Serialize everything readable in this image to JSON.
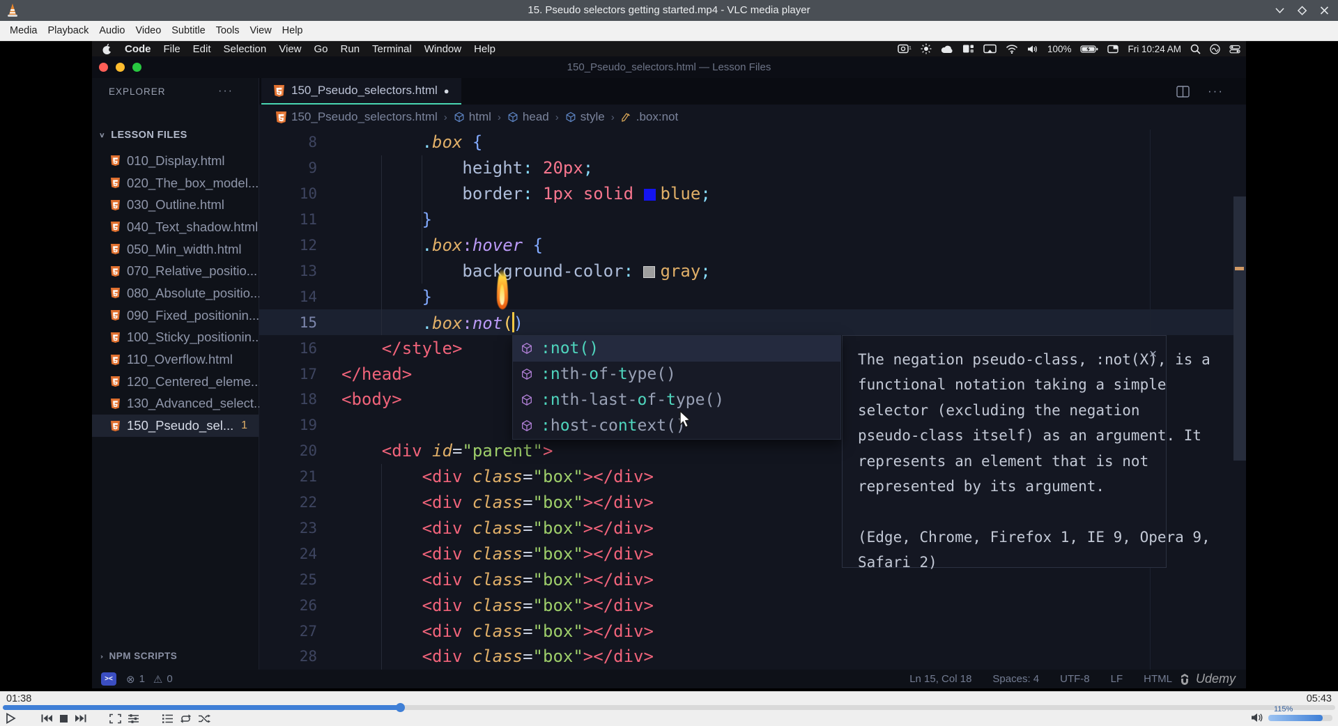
{
  "vlc": {
    "title": "15. Pseudo selectors getting started.mp4 - VLC media player",
    "menu": [
      "Media",
      "Playback",
      "Audio",
      "Video",
      "Subtitle",
      "Tools",
      "View",
      "Help"
    ],
    "window_icons": [
      "minimize-icon",
      "maximize-icon",
      "close-icon"
    ],
    "time_elapsed": "01:38",
    "time_total": "05:43",
    "volume_label": "115%",
    "transport_icons": [
      "play-icon",
      "previous-icon",
      "stop-icon",
      "next-icon",
      "fullscreen-icon",
      "extended-settings-icon",
      "playlist-icon",
      "loop-icon",
      "shuffle-icon"
    ],
    "accent_color": "#3f7fd6"
  },
  "macos": {
    "apple_icon": "apple-icon",
    "menu": [
      "Code",
      "File",
      "Edit",
      "Selection",
      "View",
      "Go",
      "Run",
      "Terminal",
      "Window",
      "Help"
    ],
    "status": [
      {
        "icon": "screen-record-icon"
      },
      {
        "icon": "brightness-icon"
      },
      {
        "icon": "cloud-icon"
      },
      {
        "icon": "stage-manager-icon"
      },
      {
        "icon": "screen-mirroring-icon"
      },
      {
        "icon": "wifi-icon"
      },
      {
        "icon": "volume-icon"
      },
      {
        "text": "100%"
      },
      {
        "icon": "battery-charging-icon"
      },
      {
        "icon": "window-icon"
      },
      {
        "text": "Fri 10:24 AM"
      },
      {
        "icon": "search-icon"
      },
      {
        "icon": "siri-icon"
      },
      {
        "icon": "control-center-icon"
      }
    ]
  },
  "vscode": {
    "window_title": "150_Pseudo_selectors.html — Lesson Files",
    "explorer_label": "EXPLORER",
    "section_label": "LESSON FILES",
    "files": [
      {
        "name": "010_Display.html"
      },
      {
        "name": "020_The_box_model...."
      },
      {
        "name": "030_Outline.html"
      },
      {
        "name": "040_Text_shadow.html"
      },
      {
        "name": "050_Min_width.html"
      },
      {
        "name": "070_Relative_positio..."
      },
      {
        "name": "080_Absolute_positio..."
      },
      {
        "name": "090_Fixed_positionin..."
      },
      {
        "name": "100_Sticky_positionin..."
      },
      {
        "name": "110_Overflow.html"
      },
      {
        "name": "120_Centered_eleme..."
      },
      {
        "name": "130_Advanced_select..."
      },
      {
        "name": "150_Pseudo_sel...",
        "selected": true,
        "badge": "1"
      }
    ],
    "npm_label": "NPM SCRIPTS",
    "tab": {
      "label": "150_Pseudo_selectors.html",
      "modified_dot": "●"
    },
    "breadcrumbs": [
      {
        "icon": "html5-icon",
        "label": "150_Pseudo_selectors.html"
      },
      {
        "icon": "cube-icon",
        "label": "html"
      },
      {
        "icon": "cube-icon",
        "label": "head"
      },
      {
        "icon": "cube-icon",
        "label": "style"
      },
      {
        "icon": "selector-icon",
        "label": ".box:not"
      }
    ],
    "code_lines": [
      {
        "n": "8",
        "t": [
          [
            "pln",
            "        "
          ],
          [
            "dot",
            "."
          ],
          [
            "cls",
            "box"
          ],
          [
            "pln",
            " "
          ],
          [
            "brace",
            "{"
          ]
        ]
      },
      {
        "n": "9",
        "t": [
          [
            "pln",
            "            "
          ],
          [
            "prop",
            "height"
          ],
          [
            "pcol",
            ":"
          ],
          [
            "pln",
            " "
          ],
          [
            "num",
            "20px"
          ],
          [
            "semi",
            ";"
          ]
        ]
      },
      {
        "n": "10",
        "t": [
          [
            "pln",
            "            "
          ],
          [
            "prop",
            "border"
          ],
          [
            "pcol",
            ":"
          ],
          [
            "pln",
            " "
          ],
          [
            "num",
            "1px"
          ],
          [
            "pln",
            " "
          ],
          [
            "num",
            "solid"
          ],
          [
            "pln",
            " "
          ],
          [
            "swB",
            ""
          ],
          [
            "ckw",
            "blue"
          ],
          [
            "semi",
            ";"
          ]
        ]
      },
      {
        "n": "11",
        "t": [
          [
            "pln",
            "        "
          ],
          [
            "brace",
            "}"
          ]
        ]
      },
      {
        "n": "12",
        "t": [
          [
            "pln",
            "        "
          ],
          [
            "dot",
            "."
          ],
          [
            "cls",
            "box"
          ],
          [
            "col",
            ":"
          ],
          [
            "psd",
            "hover"
          ],
          [
            "pln",
            " "
          ],
          [
            "brace",
            "{"
          ]
        ]
      },
      {
        "n": "13",
        "t": [
          [
            "pln",
            "            "
          ],
          [
            "prop",
            "background-color"
          ],
          [
            "pcol",
            ":"
          ],
          [
            "pln",
            " "
          ],
          [
            "swG",
            ""
          ],
          [
            "ckw",
            "gray"
          ],
          [
            "semi",
            ";"
          ]
        ]
      },
      {
        "n": "14",
        "t": [
          [
            "pln",
            "        "
          ],
          [
            "brace",
            "}"
          ]
        ]
      },
      {
        "n": "15",
        "cur": true,
        "t": [
          [
            "pln",
            "        "
          ],
          [
            "dot",
            "."
          ],
          [
            "cls",
            "box"
          ],
          [
            "col",
            ":"
          ],
          [
            "psd",
            "not"
          ],
          [
            "pgold",
            "("
          ],
          [
            "cursor",
            ""
          ],
          [
            "brace",
            ")"
          ]
        ]
      },
      {
        "n": "16",
        "t": [
          [
            "pln",
            "    "
          ],
          [
            "tag",
            "</style>"
          ]
        ]
      },
      {
        "n": "17",
        "t": [
          [
            "tag",
            "</head>"
          ]
        ]
      },
      {
        "n": "18",
        "t": [
          [
            "tag",
            "<body>"
          ]
        ]
      },
      {
        "n": "19",
        "t": []
      },
      {
        "n": "20",
        "t": [
          [
            "pln",
            "    "
          ],
          [
            "tag",
            "<div"
          ],
          [
            "pln",
            " "
          ],
          [
            "attr",
            "id"
          ],
          [
            "eq",
            "="
          ],
          [
            "str",
            "\"parent\""
          ],
          [
            "tag",
            ">"
          ]
        ]
      },
      {
        "n": "21",
        "t": [
          [
            "pln",
            "        "
          ],
          [
            "tag",
            "<div"
          ],
          [
            "pln",
            " "
          ],
          [
            "attr",
            "class"
          ],
          [
            "eq",
            "="
          ],
          [
            "str",
            "\"box\""
          ],
          [
            "tag",
            "></div>"
          ]
        ]
      },
      {
        "n": "22",
        "t": [
          [
            "pln",
            "        "
          ],
          [
            "tag",
            "<div"
          ],
          [
            "pln",
            " "
          ],
          [
            "attr",
            "class"
          ],
          [
            "eq",
            "="
          ],
          [
            "str",
            "\"box\""
          ],
          [
            "tag",
            "></div>"
          ]
        ]
      },
      {
        "n": "23",
        "t": [
          [
            "pln",
            "        "
          ],
          [
            "tag",
            "<div"
          ],
          [
            "pln",
            " "
          ],
          [
            "attr",
            "class"
          ],
          [
            "eq",
            "="
          ],
          [
            "str",
            "\"box\""
          ],
          [
            "tag",
            "></div>"
          ]
        ]
      },
      {
        "n": "24",
        "t": [
          [
            "pln",
            "        "
          ],
          [
            "tag",
            "<div"
          ],
          [
            "pln",
            " "
          ],
          [
            "attr",
            "class"
          ],
          [
            "eq",
            "="
          ],
          [
            "str",
            "\"box\""
          ],
          [
            "tag",
            "></div>"
          ]
        ]
      },
      {
        "n": "25",
        "t": [
          [
            "pln",
            "        "
          ],
          [
            "tag",
            "<div"
          ],
          [
            "pln",
            " "
          ],
          [
            "attr",
            "class"
          ],
          [
            "eq",
            "="
          ],
          [
            "str",
            "\"box\""
          ],
          [
            "tag",
            "></div>"
          ]
        ]
      },
      {
        "n": "26",
        "t": [
          [
            "pln",
            "        "
          ],
          [
            "tag",
            "<div"
          ],
          [
            "pln",
            " "
          ],
          [
            "attr",
            "class"
          ],
          [
            "eq",
            "="
          ],
          [
            "str",
            "\"box\""
          ],
          [
            "tag",
            "></div>"
          ]
        ]
      },
      {
        "n": "27",
        "t": [
          [
            "pln",
            "        "
          ],
          [
            "tag",
            "<div"
          ],
          [
            "pln",
            " "
          ],
          [
            "attr",
            "class"
          ],
          [
            "eq",
            "="
          ],
          [
            "str",
            "\"box\""
          ],
          [
            "tag",
            "></div>"
          ]
        ]
      },
      {
        "n": "28",
        "t": [
          [
            "pln",
            "        "
          ],
          [
            "tag",
            "<div"
          ],
          [
            "pln",
            " "
          ],
          [
            "attr",
            "class"
          ],
          [
            "eq",
            "="
          ],
          [
            "str",
            "\"box\""
          ],
          [
            "tag",
            "></div>"
          ]
        ]
      }
    ],
    "suggest": {
      "items": [
        {
          "selected": true,
          "parts": [
            [
              ":not()",
              1
            ]
          ]
        },
        {
          "parts": [
            [
              ":n",
              1
            ],
            [
              "th-",
              0
            ],
            [
              "o",
              1
            ],
            [
              "f-",
              0
            ],
            [
              "t",
              1
            ],
            [
              "ype()",
              0
            ]
          ]
        },
        {
          "parts": [
            [
              ":n",
              1
            ],
            [
              "th-last-",
              0
            ],
            [
              "o",
              1
            ],
            [
              "f-",
              0
            ],
            [
              "t",
              1
            ],
            [
              "ype()",
              0
            ]
          ]
        },
        {
          "parts": [
            [
              ":",
              1
            ],
            [
              "h",
              0
            ],
            [
              "o",
              1
            ],
            [
              "st-co",
              0
            ],
            [
              "nt",
              1
            ],
            [
              "ext()",
              0
            ]
          ]
        }
      ],
      "icon": "symbol-pseudo-icon"
    },
    "hover_doc": {
      "close_glyph": "✕",
      "lines": [
        "The negation pseudo-class, :not(X), is a",
        "functional notation taking a simple",
        "selector (excluding the negation",
        "pseudo-class itself) as an argument. It",
        "represents an element that is not",
        "represented by its argument.",
        "",
        "(Edge, Chrome, Firefox 1, IE 9, Opera 9,",
        "Safari 2)"
      ]
    },
    "status_left": {
      "remote_glyph": "><",
      "errors": "1",
      "warnings": "0"
    },
    "status_right": [
      "Ln 15, Col 18",
      "Spaces: 4",
      "UTF-8",
      "LF",
      "HTML"
    ],
    "watermark": "Udemy",
    "tab_underline_color": "#49d6b2"
  }
}
